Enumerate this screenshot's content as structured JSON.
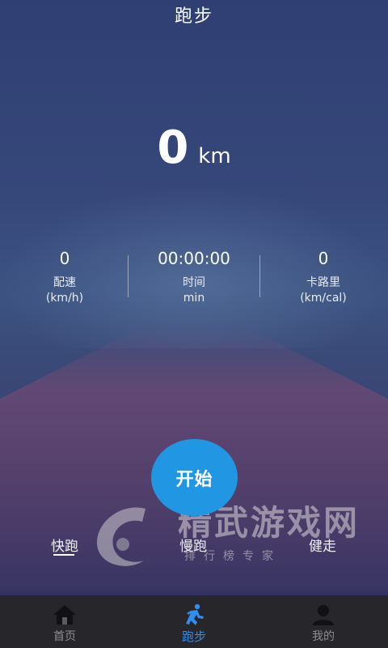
{
  "header": {
    "title": "跑步"
  },
  "distance": {
    "value": "0",
    "unit": "km"
  },
  "stats": [
    {
      "value": "0",
      "label": "配速",
      "unit": "(km/h)"
    },
    {
      "value": "00:00:00",
      "label": "时间",
      "unit": "min"
    },
    {
      "value": "0",
      "label": "卡路里",
      "unit": "(km/cal)"
    }
  ],
  "start_button": {
    "label": "开始"
  },
  "modes": [
    {
      "label": "快跑",
      "selected": true
    },
    {
      "label": "慢跑",
      "selected": false
    },
    {
      "label": "健走",
      "selected": false
    }
  ],
  "watermark": {
    "title": "精武游戏网",
    "subtitle": "排行榜专家"
  },
  "tabbar": [
    {
      "label": "首页",
      "icon": "home-icon"
    },
    {
      "label": "跑步",
      "icon": "running-icon",
      "active": true
    },
    {
      "label": "我的",
      "icon": "user-icon"
    }
  ],
  "colors": {
    "accent": "#2196e3",
    "tab_active": "#2f8ef0",
    "tabbar_bg": "#26262b"
  }
}
